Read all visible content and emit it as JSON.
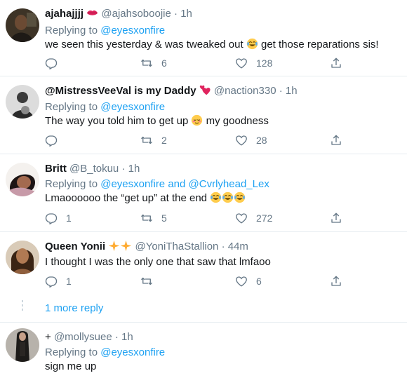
{
  "tweets": [
    {
      "name": "ajahajjjj",
      "name_emoji": "lips",
      "handle": "@ajahsoboojie",
      "time": "1h",
      "reply_prefix": "Replying to",
      "reply_to": "@eyesxonfire",
      "text_before": "we seen this yesterday & was tweaked out",
      "text_emoji": "joy",
      "text_after": "get those reparations sis!",
      "replies": "",
      "retweets": "6",
      "likes": "128"
    },
    {
      "name": "@MistressVeeVal is my Daddy",
      "name_emoji": "two-hearts",
      "handle": "@naction330",
      "time": "1h",
      "reply_prefix": "Replying to",
      "reply_to": "@eyesxonfire",
      "text_before": "The way you told him to get up",
      "text_emoji": "relieved-blush",
      "text_after": "my goodness",
      "replies": "",
      "retweets": "2",
      "likes": "28"
    },
    {
      "name": "Britt",
      "handle": "@B_tokuu",
      "time": "1h",
      "reply_prefix": "Replying to",
      "reply_to": "@eyesxonfire",
      "reply_and": "and",
      "reply_to_2": "@Cvrlyhead_Lex",
      "text_before": "Lmaoooooo the “get up” at the end",
      "text_emoji": "joy",
      "replies": "1",
      "retweets": "5",
      "likes": "272"
    },
    {
      "name": "Queen Yonii",
      "name_emoji": "sparkles",
      "handle": "@YoniThaStallion",
      "time": "44m",
      "text_before": "I thought I was the only one that saw that lmfaoo",
      "replies": "1",
      "retweets": "",
      "likes": "6"
    },
    {
      "name_plain": "+",
      "handle": "@mollysuee",
      "time": "1h",
      "reply_prefix": "Replying to",
      "reply_to": "@eyesxonfire",
      "text_before": "sign me up"
    }
  ],
  "more_replies": "1 more reply",
  "separator": "·",
  "colors": {
    "link": "#1da1f2",
    "muted": "#657786",
    "text": "#14171a",
    "divider": "#e6ecf0",
    "heart_pink": "#e0245e"
  }
}
